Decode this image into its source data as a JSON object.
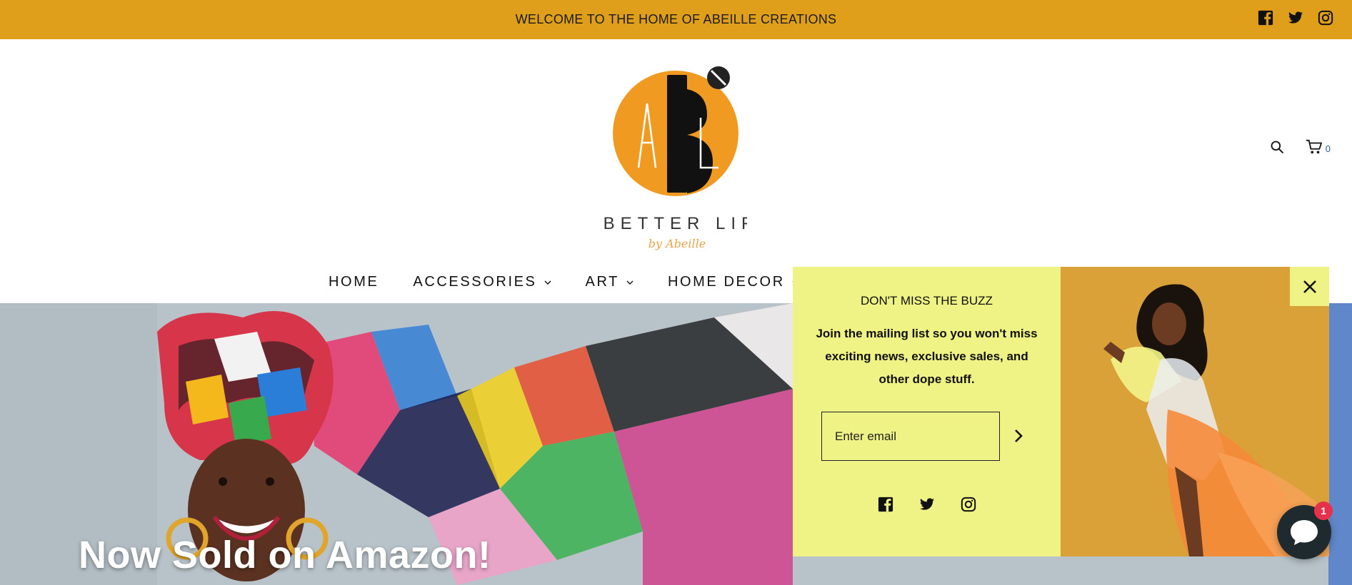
{
  "announcement": {
    "text": "WELCOME TO THE HOME OF ABEILLE CREATIONS"
  },
  "header": {
    "logo_tagline": "A BETTER LIFE",
    "logo_signature": "by Abeille",
    "cart_count": "0"
  },
  "nav": {
    "items": [
      {
        "label": "HOME"
      },
      {
        "label": "ACCESSORIES"
      },
      {
        "label": "ART"
      },
      {
        "label": "HOME DECOR"
      }
    ]
  },
  "hero": {
    "title": "Now Sold on Amazon!"
  },
  "popup": {
    "heading": "DON'T MISS THE BUZZ",
    "text": "Join the mailing list so you won't miss exciting news, exclusive sales, and other dope stuff.",
    "email_placeholder": "Enter email"
  },
  "chat": {
    "badge": "1"
  },
  "colors": {
    "announcement_bg": "#e09f1b",
    "popup_bg": "#eff284",
    "logo_orange": "#f19a22",
    "chat_bg": "#1f2a2e",
    "badge_red": "#e7304a"
  },
  "icons": [
    "facebook-icon",
    "twitter-icon",
    "instagram-icon",
    "search-icon",
    "cart-icon",
    "chevron-down-icon",
    "arrow-right-icon",
    "close-icon",
    "chat-icon"
  ]
}
